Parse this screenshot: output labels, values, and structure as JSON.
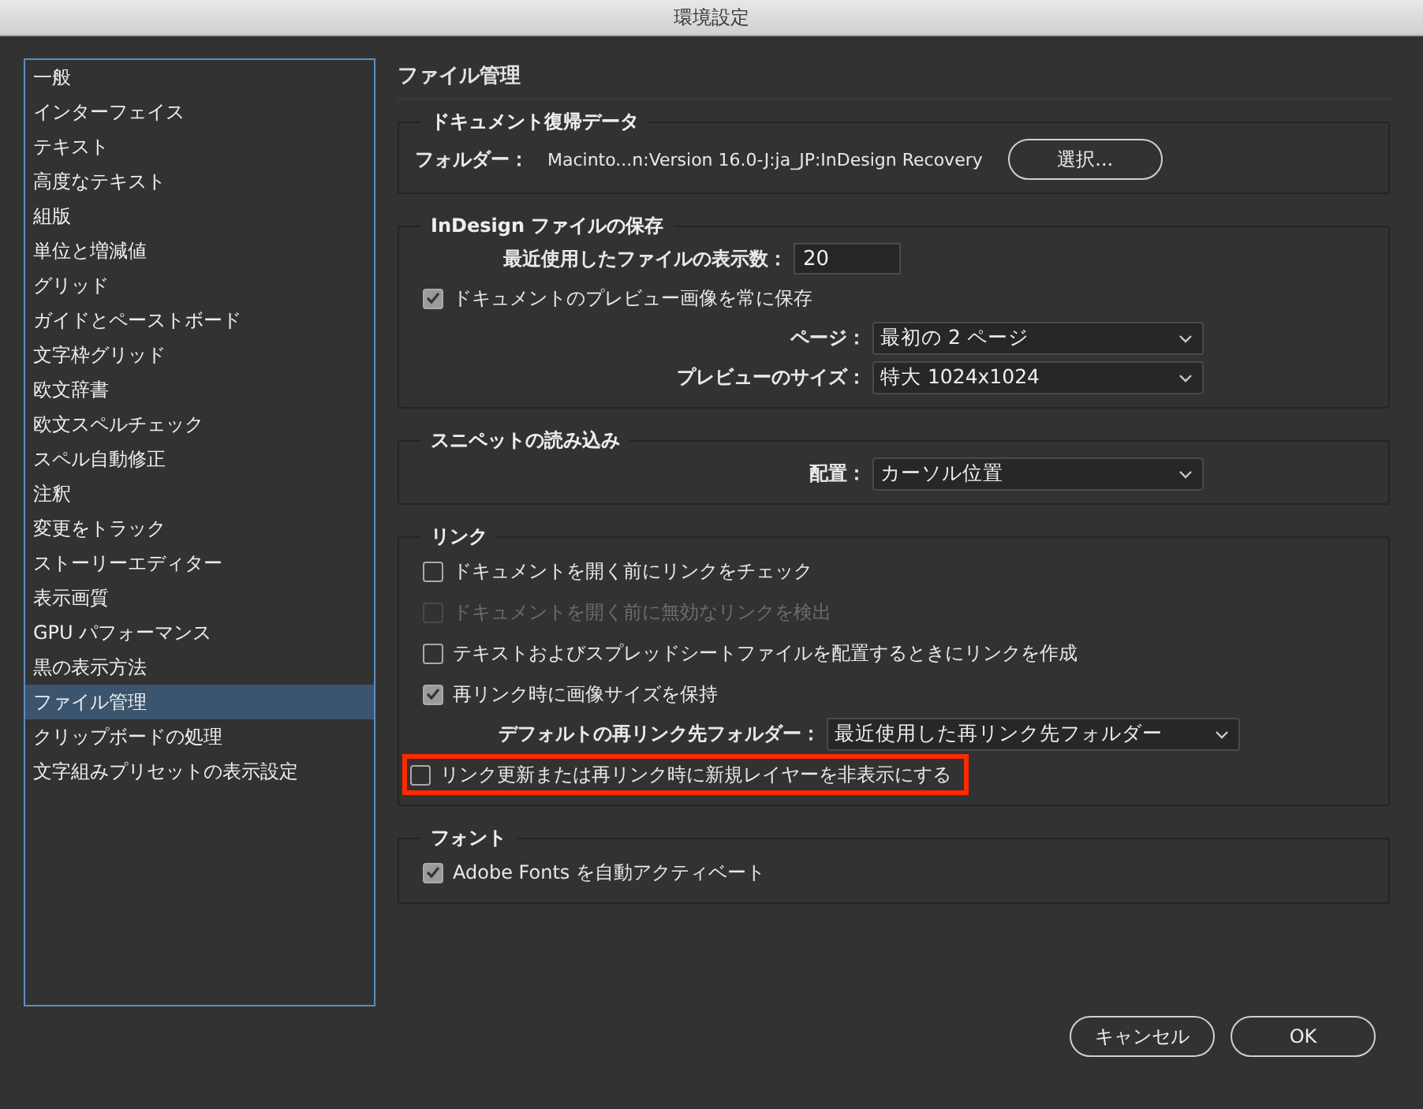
{
  "window": {
    "title": "環境設定"
  },
  "sidebar": {
    "items": [
      {
        "label": "一般",
        "selected": false
      },
      {
        "label": "インターフェイス",
        "selected": false
      },
      {
        "label": "テキスト",
        "selected": false
      },
      {
        "label": "高度なテキスト",
        "selected": false
      },
      {
        "label": "組版",
        "selected": false
      },
      {
        "label": "単位と増減値",
        "selected": false
      },
      {
        "label": "グリッド",
        "selected": false
      },
      {
        "label": "ガイドとペーストボード",
        "selected": false
      },
      {
        "label": "文字枠グリッド",
        "selected": false
      },
      {
        "label": "欧文辞書",
        "selected": false
      },
      {
        "label": "欧文スペルチェック",
        "selected": false
      },
      {
        "label": "スペル自動修正",
        "selected": false
      },
      {
        "label": "注釈",
        "selected": false
      },
      {
        "label": "変更をトラック",
        "selected": false
      },
      {
        "label": "ストーリーエディター",
        "selected": false
      },
      {
        "label": "表示画質",
        "selected": false
      },
      {
        "label": "GPU パフォーマンス",
        "selected": false
      },
      {
        "label": "黒の表示方法",
        "selected": false
      },
      {
        "label": "ファイル管理",
        "selected": true
      },
      {
        "label": "クリップボードの処理",
        "selected": false
      },
      {
        "label": "文字組みプリセットの表示設定",
        "selected": false
      }
    ]
  },
  "page_title": "ファイル管理",
  "groups": [
    {
      "kind": "recovery",
      "title": "ドキュメント復帰データ",
      "rows": [
        {
          "kind": "path",
          "label": "フォルダー：",
          "value": "Macinto...n:Version 16.0-J:ja_JP:InDesign Recovery",
          "button": "選択..."
        }
      ]
    },
    {
      "kind": "save",
      "title": "InDesign ファイルの保存",
      "rows": [
        {
          "kind": "number",
          "label": "最近使用したファイルの表示数：",
          "value": "20"
        },
        {
          "kind": "checkbox",
          "label": "ドキュメントのプレビュー画像を常に保存",
          "checked": true,
          "disabled": false,
          "highlighted": false
        },
        {
          "kind": "dropdown",
          "label": "ページ：",
          "value": "最初の 2 ページ"
        },
        {
          "kind": "dropdown",
          "label": "プレビューのサイズ：",
          "value": "特大 1024x1024"
        }
      ]
    },
    {
      "kind": "snippet",
      "title": "スニペットの読み込み",
      "rows": [
        {
          "kind": "dropdown",
          "label": "配置：",
          "value": "カーソル位置"
        }
      ]
    },
    {
      "kind": "links",
      "title": "リンク",
      "rows": [
        {
          "kind": "checkbox",
          "label": "ドキュメントを開く前にリンクをチェック",
          "checked": false,
          "disabled": false,
          "highlighted": false
        },
        {
          "kind": "checkbox",
          "label": "ドキュメントを開く前に無効なリンクを検出",
          "checked": false,
          "disabled": true,
          "highlighted": false
        },
        {
          "kind": "checkbox",
          "label": "テキストおよびスプレッドシートファイルを配置するときにリンクを作成",
          "checked": false,
          "disabled": false,
          "highlighted": false
        },
        {
          "kind": "checkbox",
          "label": "再リンク時に画像サイズを保持",
          "checked": true,
          "disabled": false,
          "highlighted": false
        },
        {
          "kind": "dropdown",
          "label": "デフォルトの再リンク先フォルダー：",
          "value": "最近使用した再リンク先フォルダー"
        },
        {
          "kind": "checkbox",
          "label": "リンク更新または再リンク時に新規レイヤーを非表示にする",
          "checked": false,
          "disabled": false,
          "highlighted": true
        }
      ]
    },
    {
      "kind": "fonts",
      "title": "フォント",
      "rows": [
        {
          "kind": "checkbox",
          "label": "Adobe Fonts を自動アクティベート",
          "checked": true,
          "disabled": false,
          "highlighted": false
        }
      ]
    }
  ],
  "buttons": [
    {
      "label": "キャンセル"
    },
    {
      "label": "OK"
    }
  ]
}
